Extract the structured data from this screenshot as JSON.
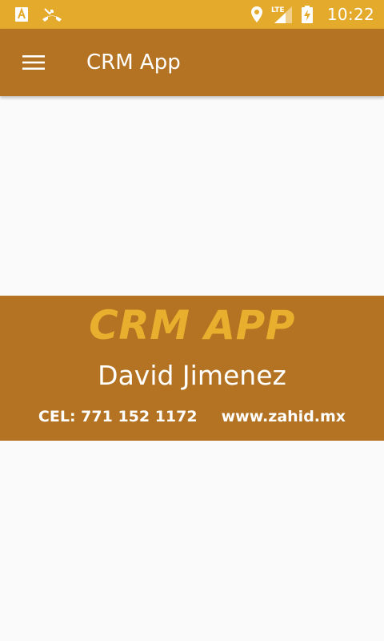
{
  "status_bar": {
    "time": "10:22",
    "network_label": "LTE",
    "icons": [
      "autofill-icon",
      "missed-call-icon",
      "location-icon",
      "signal-icon",
      "battery-charging-icon"
    ]
  },
  "app_bar": {
    "title": "CRM App",
    "menu_icon": "hamburger-menu-icon"
  },
  "card": {
    "brand": "CRM APP",
    "name": "David Jimenez",
    "phone": "CEL: 771 152 1172",
    "website": "www.zahid.mx"
  },
  "colors": {
    "status_bar": "#e4aa2c",
    "primary": "#b47322",
    "accent": "#e8ae2d",
    "background": "#fafafa"
  }
}
